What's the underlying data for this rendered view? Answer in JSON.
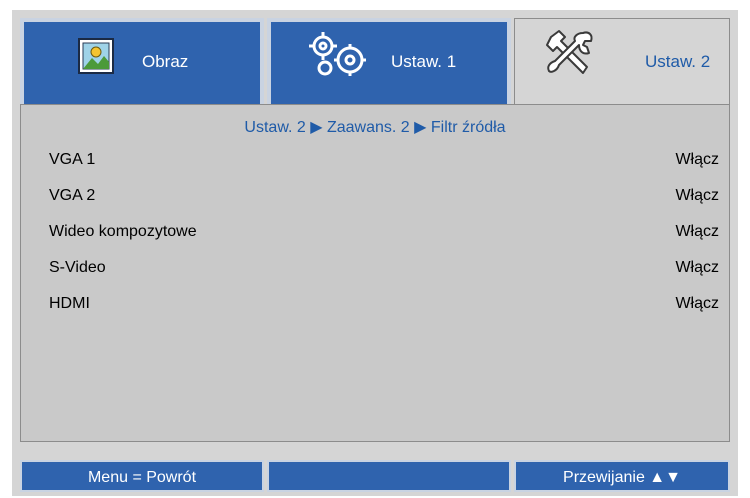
{
  "tabs": [
    {
      "label": "Obraz",
      "icon": "picture-icon"
    },
    {
      "label": "Ustaw. 1",
      "icon": "gears-icon"
    },
    {
      "label": "Ustaw. 2",
      "icon": "tools-icon"
    }
  ],
  "breadcrumb": "Ustaw. 2 ▶ Zaawans. 2 ▶ Filtr źródła",
  "rows": [
    {
      "label": "VGA 1",
      "value": "Włącz"
    },
    {
      "label": "VGA 2",
      "value": "Włącz"
    },
    {
      "label": "Wideo kompozytowe",
      "value": "Włącz"
    },
    {
      "label": "S-Video",
      "value": "Włącz"
    },
    {
      "label": "HDMI",
      "value": "Włącz"
    }
  ],
  "footer": {
    "left": "Menu = Powrót",
    "middle": "",
    "right": "Przewijanie ▲▼"
  },
  "colors": {
    "accent": "#2f63ae",
    "panel": "#c9c9c9",
    "text_blue": "#1f5ba8"
  }
}
